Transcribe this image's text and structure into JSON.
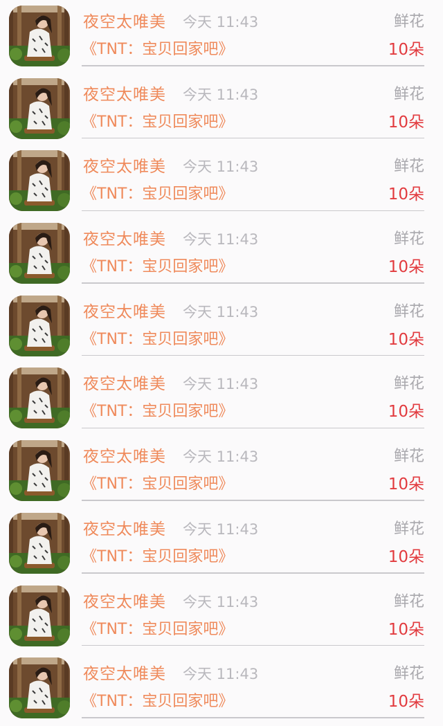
{
  "gift_list": {
    "items": [
      {
        "name": "夜空太唯美",
        "time": "今天 11:43",
        "gift_type": "鲜花",
        "title": "《TNT：宝贝回家吧》",
        "amount": "10朵"
      },
      {
        "name": "夜空太唯美",
        "time": "今天 11:43",
        "gift_type": "鲜花",
        "title": "《TNT：宝贝回家吧》",
        "amount": "10朵"
      },
      {
        "name": "夜空太唯美",
        "time": "今天 11:43",
        "gift_type": "鲜花",
        "title": "《TNT：宝贝回家吧》",
        "amount": "10朵"
      },
      {
        "name": "夜空太唯美",
        "time": "今天 11:43",
        "gift_type": "鲜花",
        "title": "《TNT：宝贝回家吧》",
        "amount": "10朵"
      },
      {
        "name": "夜空太唯美",
        "time": "今天 11:43",
        "gift_type": "鲜花",
        "title": "《TNT：宝贝回家吧》",
        "amount": "10朵"
      },
      {
        "name": "夜空太唯美",
        "time": "今天 11:43",
        "gift_type": "鲜花",
        "title": "《TNT：宝贝回家吧》",
        "amount": "10朵"
      },
      {
        "name": "夜空太唯美",
        "time": "今天 11:43",
        "gift_type": "鲜花",
        "title": "《TNT：宝贝回家吧》",
        "amount": "10朵"
      },
      {
        "name": "夜空太唯美",
        "time": "今天 11:43",
        "gift_type": "鲜花",
        "title": "《TNT：宝贝回家吧》",
        "amount": "10朵"
      },
      {
        "name": "夜空太唯美",
        "time": "今天 11:43",
        "gift_type": "鲜花",
        "title": "《TNT：宝贝回家吧》",
        "amount": "10朵"
      },
      {
        "name": "夜空太唯美",
        "time": "今天 11:43",
        "gift_type": "鲜花",
        "title": "《TNT：宝贝回家吧》",
        "amount": "10朵"
      }
    ]
  },
  "colors": {
    "name": "#ef8a5b",
    "time": "#b9b8bd",
    "gift_type": "#a9a8ad",
    "amount": "#e23b3f",
    "divider": "#c9c8cc",
    "background": "#fbfafb"
  }
}
